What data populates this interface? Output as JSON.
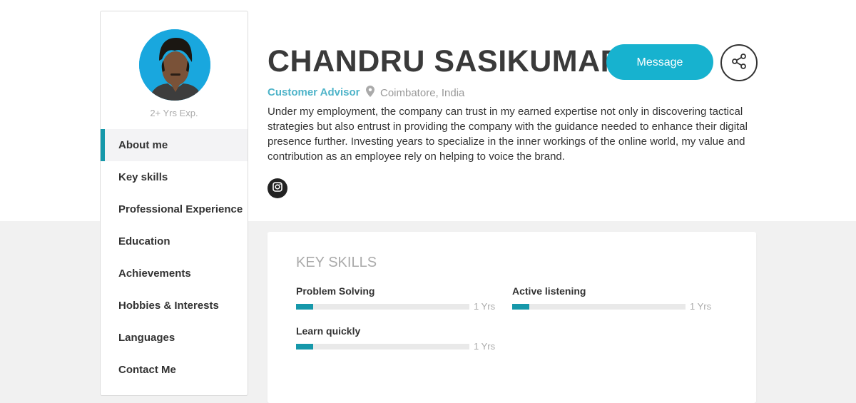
{
  "profile": {
    "name": "CHANDRU SASIKUMAR",
    "role": "Customer Advisor",
    "location": "Coimbatore, India",
    "experience": "2+ Yrs Exp.",
    "bio": "Under my employment, the company can trust in my earned expertise not only in discovering tactical strategies but also entrust in providing the company with the guidance needed to enhance their digital presence further. Investing years to specialize in the inner workings of the online world, my value and contribution as an employee rely on helping to voice the brand."
  },
  "actions": {
    "message_label": "Message"
  },
  "nav": {
    "items": [
      {
        "label": "About me"
      },
      {
        "label": "Key skills"
      },
      {
        "label": "Professional Experience"
      },
      {
        "label": "Education"
      },
      {
        "label": "Achievements"
      },
      {
        "label": "Hobbies & Interests"
      },
      {
        "label": "Languages"
      },
      {
        "label": "Contact Me"
      }
    ]
  },
  "key_skills": {
    "title": "KEY SKILLS",
    "items": [
      {
        "name": "Problem Solving",
        "years": "1 Yrs",
        "level": 0.1
      },
      {
        "name": "Active listening",
        "years": "1 Yrs",
        "level": 0.1
      },
      {
        "name": "Learn quickly",
        "years": "1 Yrs",
        "level": 0.1
      }
    ]
  },
  "colors": {
    "accent": "#17b2cf",
    "bar_fill": "#1698aa",
    "role_text": "#4fb4c9"
  },
  "icons": [
    "location-pin-icon",
    "share-icon",
    "instagram-icon",
    "avatar-photo"
  ]
}
